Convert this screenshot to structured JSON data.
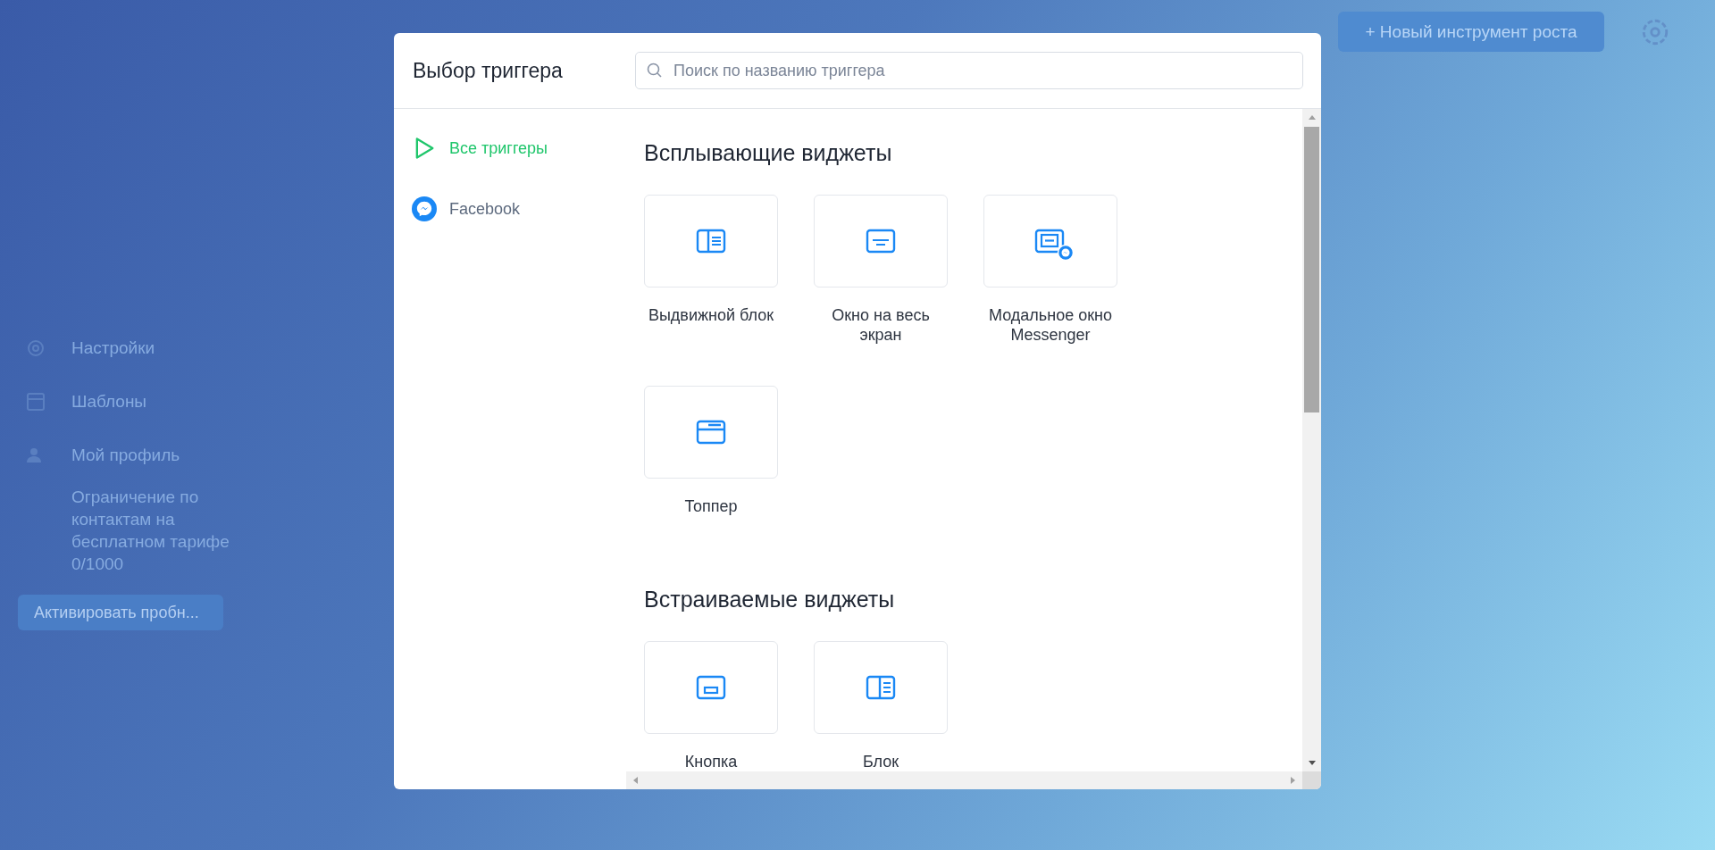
{
  "background": {
    "new_tool_button": "+ Новый инструмент роста",
    "sidebar": [
      {
        "label": "Настройки",
        "kind": "gear"
      },
      {
        "label": "Шаблоны",
        "kind": "template"
      },
      {
        "label": "Мой профиль",
        "kind": "profile"
      }
    ],
    "limit_note": "Ограничение по контактам на бесплатном тарифе",
    "limit_count": "0/1000",
    "trial_button": "Активировать пробн..."
  },
  "dialog": {
    "title": "Выбор триггера",
    "search": {
      "placeholder": "Поиск по названию триггера"
    },
    "nav": [
      {
        "label": "Все триггеры",
        "kind": "play",
        "selected": true
      },
      {
        "label": "Facebook",
        "kind": "messenger",
        "selected": false
      }
    ],
    "sections": [
      {
        "title": "Всплывающие виджеты",
        "items": [
          {
            "label": "Выдвижной блок",
            "kind": "slide"
          },
          {
            "label": "Окно на весь экран",
            "kind": "fullscreen"
          },
          {
            "label": "Модальное окно Messenger",
            "kind": "messenger_modal"
          },
          {
            "label": "Топпер",
            "kind": "topper"
          }
        ]
      },
      {
        "title": "Встраиваемые виджеты",
        "items": [
          {
            "label": "Кнопка",
            "kind": "button"
          },
          {
            "label": "Блок",
            "kind": "block"
          }
        ]
      }
    ]
  }
}
